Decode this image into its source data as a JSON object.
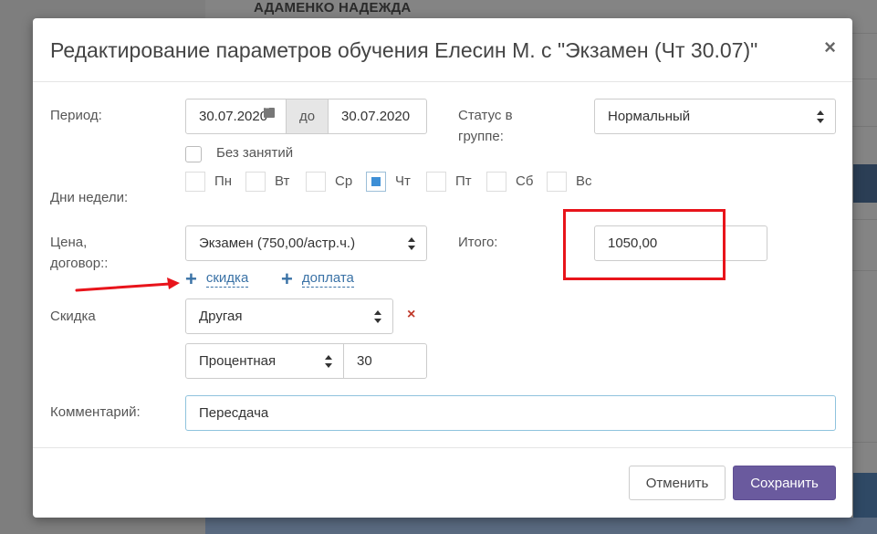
{
  "background": {
    "header_text": "АДАМЕНКО НАДЕЖДА"
  },
  "modal": {
    "title": "Редактирование параметров обучения Елесин М. с \"Экзамен (Чт 30.07)\"",
    "close": "×"
  },
  "period": {
    "label": "Период:",
    "from": "30.07.2020",
    "to_label": "до",
    "to": "30.07.2020",
    "no_classes_label": "Без занятий",
    "no_classes_checked": false
  },
  "status": {
    "label_line1": "Статус в",
    "label_line2": "группе:",
    "value": "Нормальный"
  },
  "weekdays": {
    "label": "Дни недели:",
    "days": [
      {
        "label": "Пн",
        "checked": false
      },
      {
        "label": "Вт",
        "checked": false
      },
      {
        "label": "Ср",
        "checked": false
      },
      {
        "label": "Чт",
        "checked": true
      },
      {
        "label": "Пт",
        "checked": false
      },
      {
        "label": "Сб",
        "checked": false
      },
      {
        "label": "Вс",
        "checked": false
      }
    ]
  },
  "price": {
    "label_line1": "Цена,",
    "label_line2": "договор::",
    "value": "Экзамен (750,00/астр.ч.)"
  },
  "total": {
    "label": "Итого:",
    "value": "1050,00"
  },
  "links": {
    "discount": "скидка",
    "surcharge": "доплата"
  },
  "discount": {
    "label": "Скидка",
    "type": "Другая",
    "mode": "Процентная",
    "amount": "30",
    "remove": "×"
  },
  "comment": {
    "label": "Комментарий:",
    "value": "Пересдача"
  },
  "footer": {
    "cancel": "Отменить",
    "save": "Сохранить"
  },
  "colors": {
    "primary": "#6a5a9e",
    "link": "#3a72a6",
    "annotation": "#e8141b",
    "checked": "#3d8fd6"
  }
}
